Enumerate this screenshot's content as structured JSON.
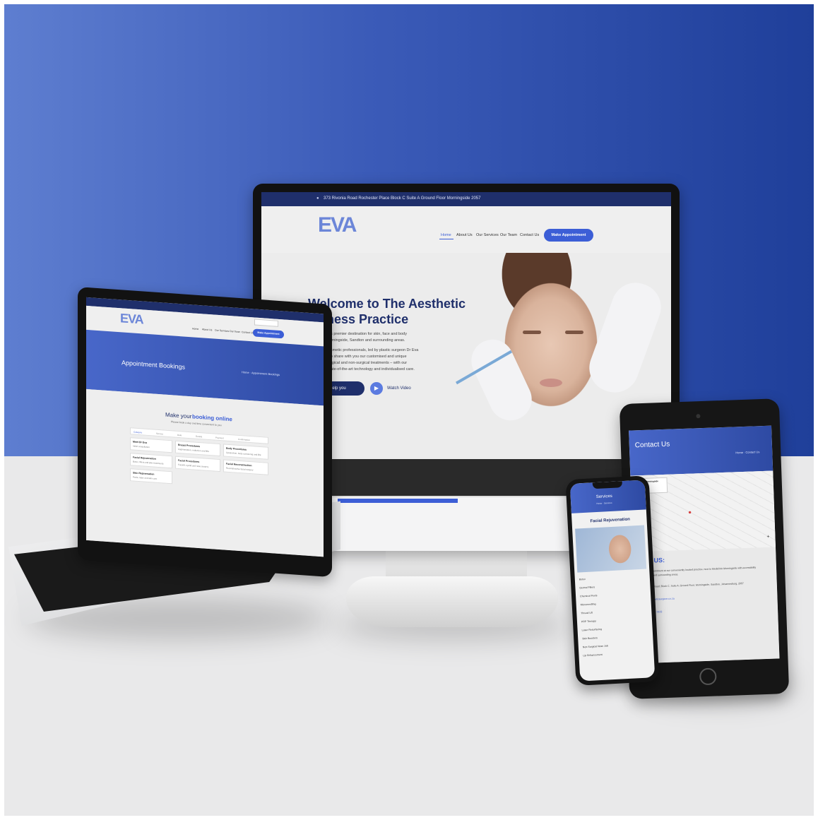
{
  "colors": {
    "accent": "#3c5ed6",
    "navy": "#1f2f6b",
    "background_blue": "#3b5bb8",
    "floor": "#e9e9ea"
  },
  "monitor": {
    "topbar_address": "373 Rivonia Road Rochester Place Block C Suite A Ground Floor Morningside 2057",
    "logo": "EVA",
    "nav": [
      "Home",
      "About Us",
      "Our Services",
      "Our Team",
      "Contact Us"
    ],
    "cta": "Make Appointment",
    "hero_title_line1": "Welcome to The Aesthetic",
    "hero_title_line2": "llness Practice",
    "hero_text": [
      "burg's premier destination for skin, face and body",
      "in Morningside, Sandton and surrounding areas.",
      "of cosmetic professionals, led by plastic surgeon Dr Eva",
      "ited to share with you our customised and unique",
      "to surgical and non-surgical treatments – with our",
      "ed state-of-the-art technology and individualised care."
    ],
    "hero_button": "n help you",
    "watch_video": "Watch Video",
    "social_icons": [
      "facebook-icon",
      "twitter-icon",
      "instagram-icon",
      "youtube-icon"
    ]
  },
  "laptop": {
    "logo": "EVA",
    "nav": [
      "Home",
      "About Us",
      "Our Services",
      "Our Team",
      "Contact Us"
    ],
    "cta": "Make Appointment",
    "banner_title": "Appointment Bookings",
    "breadcrumb": "Home · Appointment Bookings",
    "heading_plain": "Make your ",
    "heading_bold": "booking online",
    "subheading": "Please book a day and time convenient to you",
    "steps": [
      "Category",
      "Service",
      "Date",
      "Details",
      "Payment",
      "Confirmation"
    ],
    "cards": [
      {
        "title": "Meet Dr Eva",
        "text": "Initial consultation"
      },
      {
        "title": "Facial Rejuvenation",
        "text": "Botox, fillers and skin treatments"
      },
      {
        "title": "Body Procedures",
        "text": "Liposuction, body contouring and lifts"
      },
      {
        "title": "Breast Procedures",
        "text": "Augmentation, reduction and lifts"
      },
      {
        "title": "Facial Procedures",
        "text": "Facelift, eyelid and nose surgery"
      },
      {
        "title": "Facial Reconstruction",
        "text": "Reconstructive facial surgery"
      },
      {
        "title": "Skin Rejuvenation",
        "text": "Peels, laser and skin care"
      }
    ]
  },
  "tablet": {
    "banner_title": "Contact Us",
    "breadcrumb": "Home · Contact Us",
    "map_label": "Aesthetic Morningside",
    "contact_heading": "ACT US:",
    "contact_lines": [
      "Make an appointment at our conveniently located practice, next to Mediclinic Morningside with accessibility",
      "for Sandton and surrounding areas.",
      "373 Rivonia Road, Block C, Suite A, Ground Floor, Morningside, Sandton, Johannesburg, 2057",
      "info@draestheticsurgeon.co.za",
      "+27 (0)11 783 0102"
    ]
  },
  "phone": {
    "banner_title": "Services",
    "breadcrumb": "Home · Services",
    "heading": "Facial Rejuvenation",
    "list": [
      "Botox",
      "Dermal Fillers",
      "Chemical Peels",
      "Microneedling",
      "Thread Lift",
      "PRP Therapy",
      "Laser Resurfacing",
      "Skin Boosters",
      "Non-Surgical Nose Job",
      "Lip Enhancement"
    ]
  }
}
